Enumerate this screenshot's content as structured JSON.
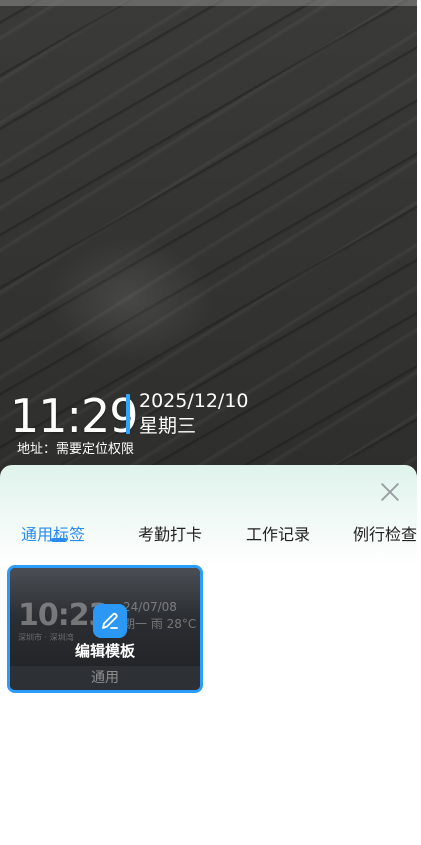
{
  "camera": {
    "watermark": {
      "time": "11:29",
      "date": "2025/12/10",
      "weekday": "星期三",
      "address": "地址：需要定位权限"
    }
  },
  "sheet": {
    "tabs": [
      {
        "label": "通用标签",
        "active": true
      },
      {
        "label": "考勤打卡",
        "active": false
      },
      {
        "label": "工作记录",
        "active": false
      },
      {
        "label": "例行检查",
        "active": false
      }
    ],
    "template_card": {
      "preview_time": "10:23",
      "preview_date": "24/07/08",
      "preview_weather": "期一  雨  28°C",
      "preview_address": "深圳市 · 深圳湾",
      "edit_label": "编辑模板",
      "footer_label": "通用"
    }
  },
  "colors": {
    "accent": "#2a8cf0",
    "watermark_bar": "#2aa8ff",
    "card_border": "#2a9dfb"
  },
  "icons": {
    "close": "close-icon",
    "edit": "pencil-icon"
  }
}
